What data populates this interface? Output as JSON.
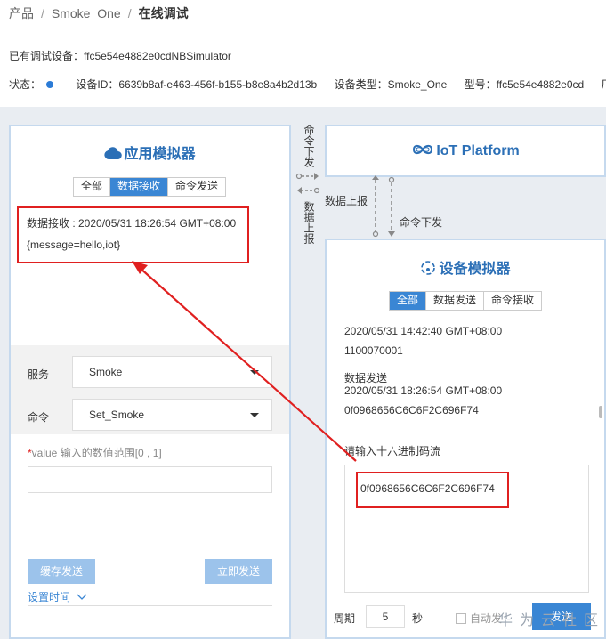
{
  "breadcrumb": {
    "item1": "产品",
    "sep1": "/",
    "item2": "Smoke_One",
    "sep2": "/",
    "current": "在线调试"
  },
  "device_line": "已有调试设备：ffc5e54e4882e0cdNBSimulator",
  "status": {
    "label": "状态：",
    "device_id": "设备ID：6639b8af-e463-456f-b155-b8e8a4b2d13b",
    "device_type": "设备类型：Smoke_One",
    "model": "型号：ffc5e54e4882e0cd",
    "truncated": "厂"
  },
  "app_sim": {
    "title": "应用模拟器",
    "tabs": [
      "全部",
      "数据接收",
      "命令发送"
    ],
    "active_tab": 1,
    "log_line1": "数据接收 : 2020/05/31 18:26:54 GMT+08:00",
    "log_line2": "{message=hello,iot}",
    "service_label": "服务",
    "service_value": "Smoke",
    "command_label": "命令",
    "command_value": "Set_Smoke",
    "value_required": "*",
    "value_label": "value 输入的数值范围[0 , 1]",
    "cache_send": "缓存发送",
    "send_now": "立即发送",
    "set_time": "设置时间"
  },
  "arrows": {
    "left_down": "命令下发",
    "left_up": "数据上报",
    "up_label": "数据上报",
    "down_label": "命令下发"
  },
  "iot": {
    "title": "IoT Platform"
  },
  "dev_sim": {
    "title": "设备模拟器",
    "tabs": [
      "全部",
      "数据发送",
      "命令接收"
    ],
    "active_tab": 0,
    "log1_time": "2020/05/31 14:42:40 GMT+08:00",
    "log1_value": "1100070001",
    "log2_label": "数据发送",
    "log2_time": "2020/05/31 18:26:54 GMT+08:00",
    "log2_value": "0f0968656C6C6F2C696F74",
    "hex_label": "请输入十六进制码流",
    "hex_value": "0f0968656C6C6F2C696F74",
    "period_label": "周期",
    "period_value": "5",
    "period_unit": "秒",
    "auto_send": "自动发",
    "send": "发送"
  },
  "watermark": "华为云社区",
  "colors": {
    "accent": "#3a86d4",
    "annotation": "#e02020",
    "panel_border": "#c5d9ee"
  }
}
